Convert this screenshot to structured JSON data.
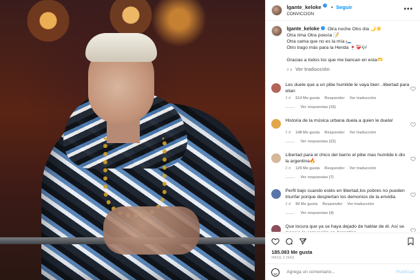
{
  "post": {
    "header": {
      "username": "lgante_keloke",
      "follow_label": "Seguir",
      "subtitle": "CONVICCION",
      "more_label": "•••"
    },
    "caption": {
      "username": "lgante_keloke",
      "lines": [
        "Otra noche Otro día 🌙☀️",
        "Otra rima Otra poesía 📝",
        "Otra cama que no es la mía 🛏️",
        "Otro trago más para la Herida 🍷❤️‍🩹🎶"
      ],
      "thanks": "Gracias a todos los que me bancan en esta🫶",
      "age": "2 d",
      "translate": "Ver traducción"
    },
    "comments": [
      {
        "text": "Les duele que a un pibe humilde le vaya bien ..libertad para elian",
        "age": "2 d",
        "likes": "514 Me gusta",
        "reply": "Responder",
        "translate": "Ver traducción",
        "replies": "Ver respuestas (16)",
        "avatar_color": "#b5635a"
      },
      {
        "text": "Historia de la música urbana duela a quien le duela!",
        "age": "2 d",
        "likes": "148 Me gusta",
        "reply": "Responder",
        "translate": "Ver traducción",
        "replies": "Ver respuestas (22)",
        "avatar_color": "#e2a64a"
      },
      {
        "text": "Libertad para el chico del barrio el pibe mas humilde k dio la argentina🔥",
        "age": "2 d",
        "likes": "129 Me gusta",
        "reply": "Responder",
        "translate": "Ver traducción",
        "replies": "Ver respuestas (7)",
        "avatar_color": "#d4b89a"
      },
      {
        "text": "Perfil bajo cuando estés en libertad,los pobres no pueden triunfar porque despiertan los demonios de la envidia",
        "age": "2 d",
        "likes": "90 Me gusta",
        "reply": "Responder",
        "translate": "Ver traducción",
        "replies": "Ver respuestas (4)",
        "avatar_color": "#5a76a8"
      },
      {
        "text": "Que locura que ya se haya dejado de hablar de él. Así se maneja la corrupción en Argentina.",
        "age": "",
        "likes": "",
        "reply": "",
        "translate": "",
        "replies": "",
        "avatar_color": "#8a4f5a"
      }
    ],
    "likes": "185.083 Me gusta",
    "date": "HACE 2 DÍAS",
    "add_comment": {
      "placeholder": "Agrega un comentario...",
      "publish": "Publicar"
    },
    "icons": {
      "like": "heart-icon",
      "comment": "comment-icon",
      "share": "send-icon",
      "save": "bookmark-icon",
      "emoji": "emoji-icon"
    }
  }
}
